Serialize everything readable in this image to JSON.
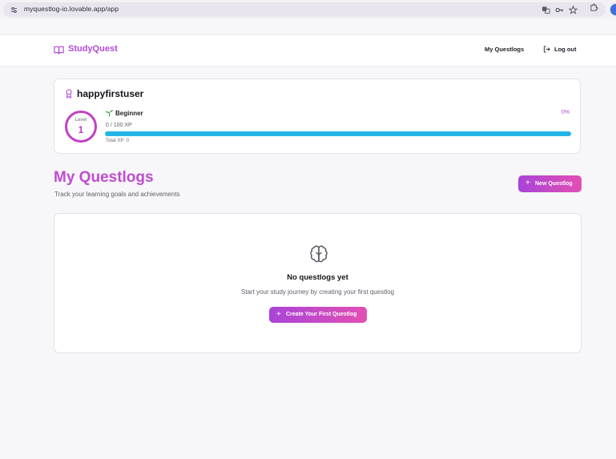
{
  "browser": {
    "url": "myquestlog-io.lovable.app/app",
    "icons": [
      "tune-icon",
      "translate-icon",
      "key-icon",
      "star-icon",
      "extensions-icon",
      "profile-avatar"
    ]
  },
  "header": {
    "brand": "StudyQuest",
    "brand_icon": "book-open-icon",
    "nav_questlogs": "My Questlogs",
    "logout_label": "Log out",
    "logout_icon": "log-out-icon"
  },
  "profile": {
    "username": "happyfirstuser",
    "badge_icon": "award-icon",
    "level_label": "Level",
    "level": "1",
    "rank_icon": "sprout-icon",
    "rank": "Beginner",
    "xp_label": "0 / 100 XP",
    "percent_label": "0%",
    "progress_fraction": 0,
    "total_xp_label": "Total XP: 0"
  },
  "questlogs": {
    "title": "My Questlogs",
    "subtitle": "Track your learning goals and achievements",
    "new_button": "New Questlog",
    "empty_icon": "brain-icon",
    "empty_title": "No questlogs yet",
    "empty_desc": "Start your study journey by creating your first questlog",
    "create_button": "Create Your First Questlog"
  },
  "colors": {
    "accent": "#bf4cd0",
    "gradient_start": "#a944d8",
    "gradient_end": "#e34fb3",
    "progress_track": "#24b5e8"
  }
}
